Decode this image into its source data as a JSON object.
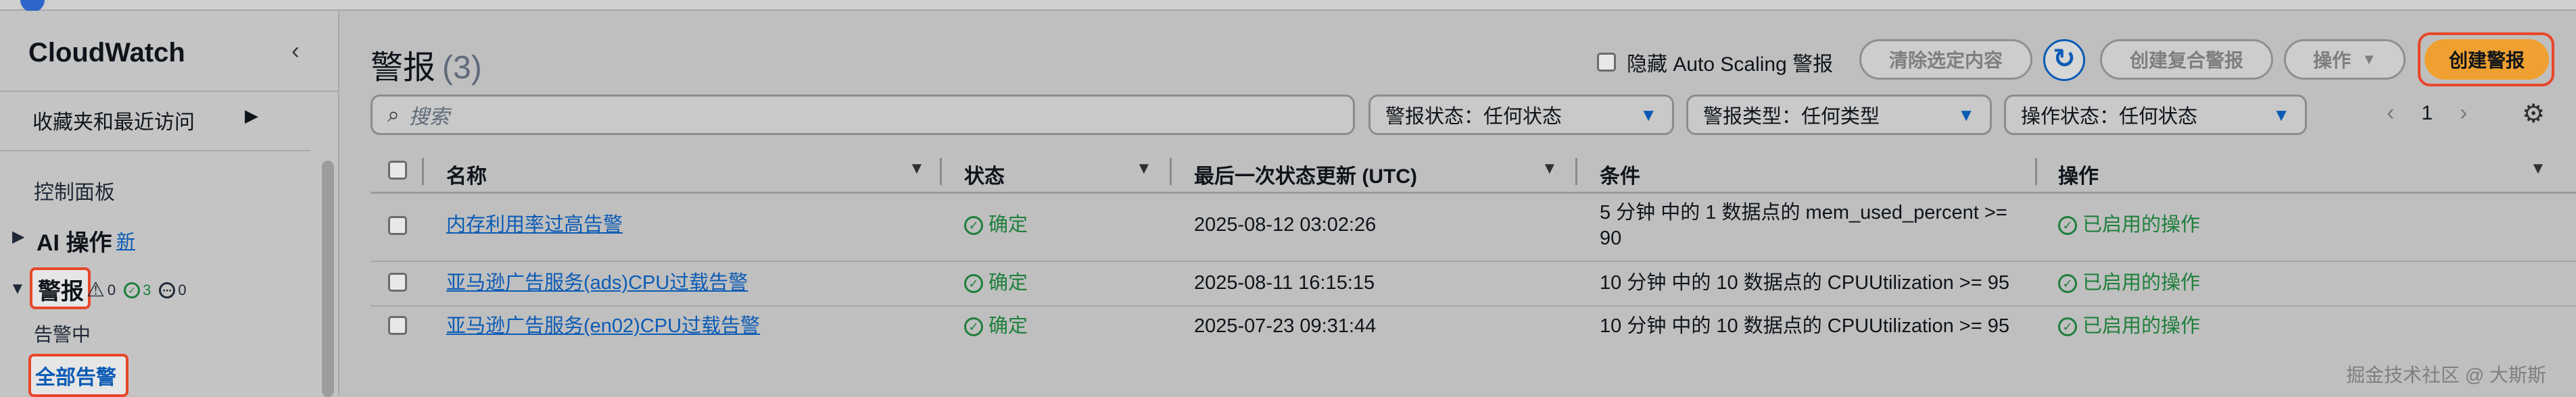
{
  "sidebar": {
    "title": "CloudWatch",
    "favorites": "收藏夹和最近访问",
    "dashboards": "控制面板",
    "ai_ops": "AI 操作",
    "ai_new": "新",
    "alarms": "警报",
    "badge_alarm_count": "0",
    "badge_ok_count": "3",
    "badge_insufficient_count": "0",
    "in_alarm": "告警中",
    "all_alarms": "全部告警"
  },
  "header": {
    "title": "警报",
    "count": "(3)",
    "hide_autoscaling": "隐藏 Auto Scaling 警报",
    "clear_selection": "清除选定内容",
    "create_composite": "创建复合警报",
    "actions": "操作",
    "create_alarm": "创建警报"
  },
  "filters": {
    "search_placeholder": "搜索",
    "alarm_state": "警报状态：任何状态",
    "alarm_type": "警报类型：任何类型",
    "action_state": "操作状态：任何状态",
    "page": "1"
  },
  "table": {
    "columns": [
      "名称",
      "状态",
      "最后一次状态更新 (UTC)",
      "条件",
      "操作"
    ],
    "rows": [
      {
        "name": "内存利用率过高告警",
        "state": "确定",
        "updated": "2025-08-12 03:02:26",
        "condition": "5 分钟 中的 1 数据点的 mem_used_percent >= 90",
        "actions": "已启用的操作"
      },
      {
        "name": "亚马逊广告服务(ads)CPU过载告警",
        "state": "确定",
        "updated": "2025-08-11 16:15:15",
        "condition": "10 分钟 中的 10 数据点的 CPUUtilization >= 95",
        "actions": "已启用的操作"
      },
      {
        "name": "亚马逊广告服务(en02)CPU过载告警",
        "state": "确定",
        "updated": "2025-07-23 09:31:44",
        "condition": "10 分钟 中的 10 数据点的 CPUUtilization >= 95",
        "actions": "已启用的操作"
      }
    ]
  },
  "watermark": "掘金技术社区 @ 大斯斯",
  "colors": {
    "accent": "#0b5bb5",
    "primary_button": "#f0a030",
    "highlight_outline": "#e8462a",
    "ok_green": "#1e7f3b"
  }
}
